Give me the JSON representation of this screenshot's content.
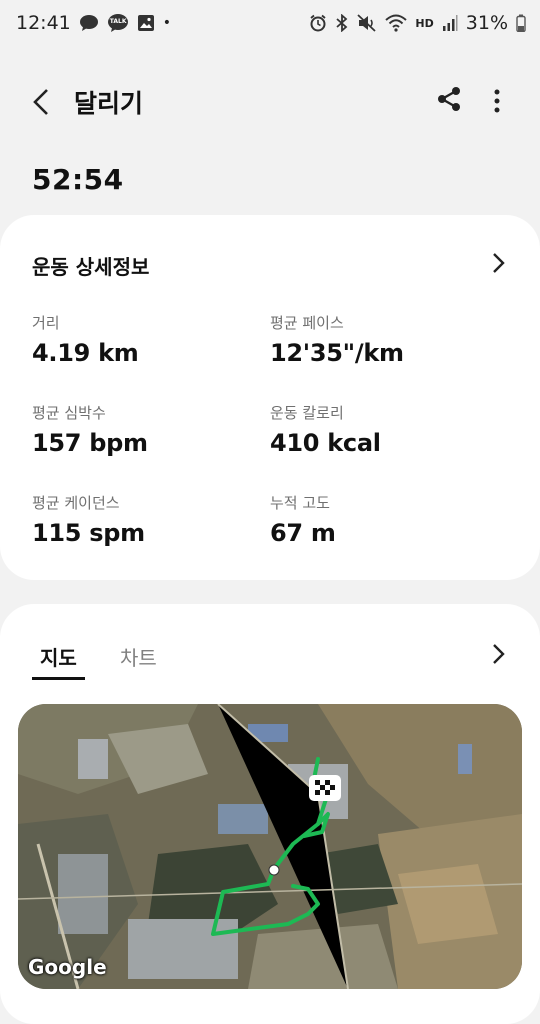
{
  "status": {
    "time": "12:41",
    "battery": "31%",
    "hd_label": "HD",
    "talk_label": "TALK",
    "icons": [
      "chat-bubble-icon",
      "talk-icon",
      "gallery-icon",
      "alarm-icon",
      "bluetooth-icon",
      "mute-icon",
      "wifi-icon",
      "hd-voice-icon",
      "signal-icon",
      "battery-icon"
    ]
  },
  "header": {
    "title": "달리기"
  },
  "summary": {
    "duration": "52:54"
  },
  "details": {
    "section_title": "운동 상세정보",
    "stats": [
      {
        "label": "거리",
        "value": "4.19 km"
      },
      {
        "label": "평균 페이스",
        "value": "12'35\"/km"
      },
      {
        "label": "평균 심박수",
        "value": "157 bpm"
      },
      {
        "label": "운동 칼로리",
        "value": "410 kcal"
      },
      {
        "label": "평균 케이던스",
        "value": "115 spm"
      },
      {
        "label": "누적 고도",
        "value": "67 m"
      }
    ]
  },
  "map_section": {
    "tabs": [
      {
        "label": "지도",
        "selected": true
      },
      {
        "label": "차트",
        "selected": false
      }
    ],
    "map_attribution": "Google",
    "route_color": "#1db954"
  }
}
